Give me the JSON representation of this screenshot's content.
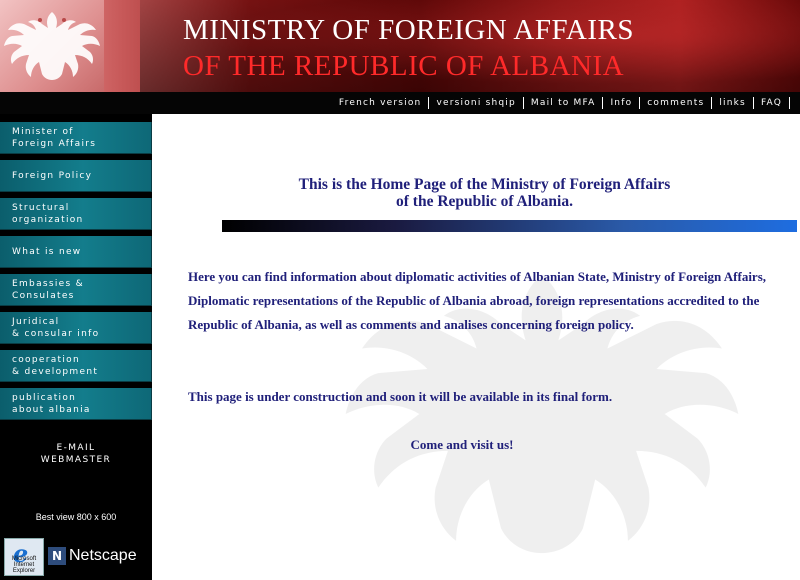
{
  "header": {
    "title_line1": "MINISTRY OF FOREIGN AFFAIRS",
    "title_line2": "OF THE REPUBLIC OF ALBANIA",
    "emblem_icon": "double-headed-eagle-icon"
  },
  "topnav": {
    "items": [
      "French version",
      "versioni shqip",
      "Mail to MFA",
      "Info",
      "comments",
      "links",
      "FAQ"
    ]
  },
  "sidebar": {
    "items": [
      "Minister of\nForeign Affairs",
      "Foreign Policy",
      "Structural\norganization",
      "What is new",
      "Embassies &\nConsulates",
      "Juridical\n& consular info",
      "cooperation\n& development",
      "publication\nabout albania"
    ],
    "email_webmaster": "E-MAIL\nWEBMASTER",
    "best_view": "Best view 800 x 600",
    "ie_caption": "Microsoft Internet Explorer",
    "netscape_label": "Netscape"
  },
  "main": {
    "heading": "This is the Home Page of the Ministry of Foreign Affairs\nof the Republic of Albania.",
    "intro": "Here you can find information about diplomatic activities of Albanian State, Ministry of  Foreign Affairs, Diplomatic representations of the Republic of Albania abroad, foreign representations accredited to the Republic of Albania, as well as comments and analises concerning foreign policy.",
    "construction": "This page is under construction and soon it will be available in its final form.",
    "visit": "Come and visit us!"
  },
  "colors": {
    "header_red": "#8a1515",
    "title_red": "#ff2a2a",
    "menu_teal": "#137d8c",
    "text_navy": "#20207a"
  }
}
